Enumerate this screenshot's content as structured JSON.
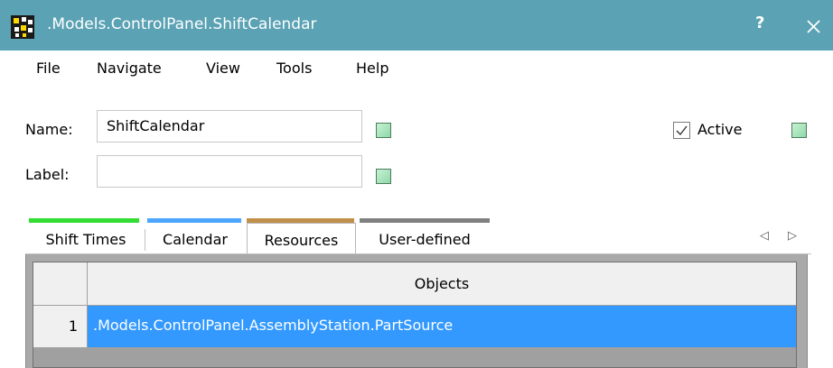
{
  "window": {
    "title": ".Models.ControlPanel.ShiftCalendar",
    "help_label": "?",
    "titlebar_color": "#5aa2b4",
    "icon": "plant-simulation-app-icon"
  },
  "menu": {
    "items": [
      "File",
      "Navigate",
      "View",
      "Tools",
      "Help"
    ]
  },
  "form": {
    "name_label": "Name:",
    "name_value": "ShiftCalendar",
    "label_label": "Label:",
    "label_value": "",
    "active_label": "Active",
    "active_checked": true,
    "inheritance_marker_color": "#a8e6bc"
  },
  "tabs": [
    {
      "label": "Shift Times",
      "color": "#33dd33",
      "active": false
    },
    {
      "label": "Calendar",
      "color": "#4da6ff",
      "active": false
    },
    {
      "label": "Resources",
      "color": "#c0904a",
      "active": true
    },
    {
      "label": "User-defined",
      "color": "#808080",
      "active": false
    }
  ],
  "table": {
    "columns": [
      "Objects"
    ],
    "rows": [
      {
        "index": "1",
        "cells": [
          ".Models.ControlPanel.AssemblyStation.PartSource"
        ],
        "selected": true
      }
    ],
    "selection_color": "#3399ff"
  }
}
